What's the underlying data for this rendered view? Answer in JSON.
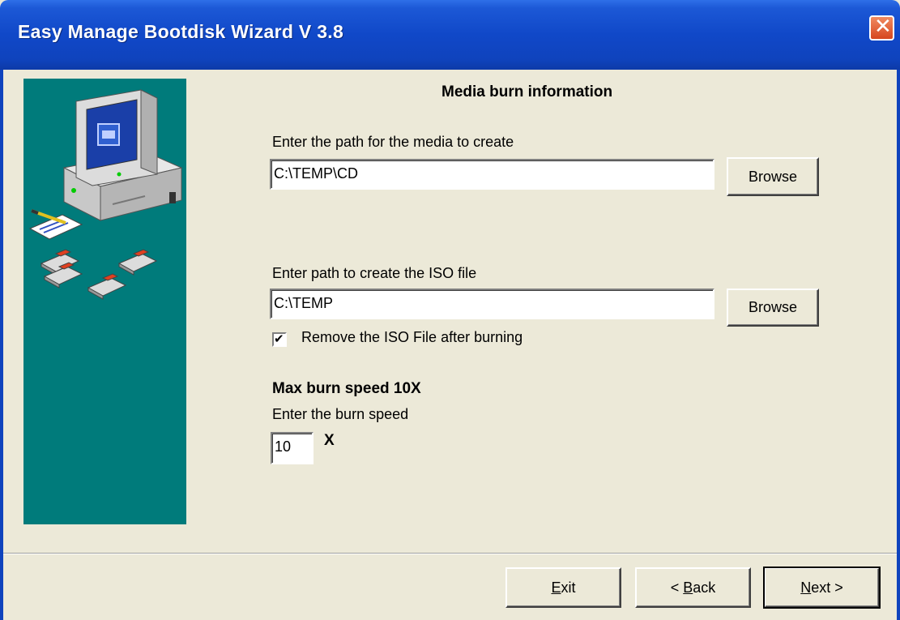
{
  "window": {
    "title": "Easy Manage Bootdisk Wizard V 3.8",
    "close_icon": "close-x-icon"
  },
  "side_panel": {
    "illustration": "computer-with-floppies-illustration",
    "bg_color": "#007b7b"
  },
  "main": {
    "heading": "Media burn information",
    "media_path": {
      "label": "Enter the path for the media to create",
      "value": "C:\\TEMP\\CD",
      "browse_label": "Browse"
    },
    "iso_path": {
      "label": "Enter path to create the ISO file",
      "value": "C:\\TEMP",
      "browse_label": "Browse"
    },
    "remove_iso": {
      "label": "Remove the ISO File after burning",
      "checked": true
    },
    "burn": {
      "max_speed_label": "Max burn speed 10X",
      "speed_prompt": "Enter the burn speed",
      "speed_value": "10",
      "speed_unit": "X"
    }
  },
  "footer": {
    "exit": {
      "accel": "E",
      "rest": "xit"
    },
    "back": {
      "prefix": "< ",
      "accel": "B",
      "rest": "ack"
    },
    "next": {
      "accel": "N",
      "rest": "ext >"
    }
  }
}
